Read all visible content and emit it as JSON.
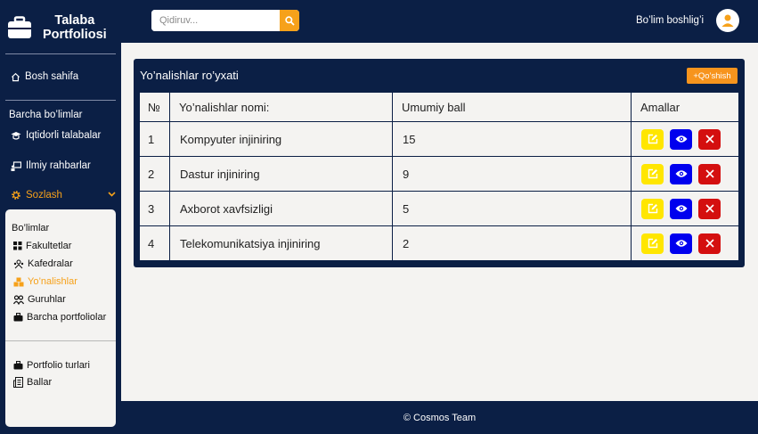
{
  "brand": {
    "line1": "Talaba",
    "line2": "Portfoliosi"
  },
  "sidebar": {
    "home": "Bosh sahifa",
    "section_label": "Barcha bo’limlar",
    "items": [
      {
        "label": "Iqtidorli talabalar"
      },
      {
        "label": "Ilmiy rahbarlar"
      },
      {
        "label": "Sozlash"
      }
    ],
    "submenu": {
      "title": "Bo’limlar",
      "items": [
        {
          "label": "Fakultetlar"
        },
        {
          "label": "Kafedralar"
        },
        {
          "label": "Yo’nalishlar"
        },
        {
          "label": "Guruhlar"
        },
        {
          "label": "Barcha portfoliolar"
        }
      ],
      "extra_items": [
        {
          "label": "Portfolio turlari"
        },
        {
          "label": "Ballar"
        }
      ]
    }
  },
  "header": {
    "search_placeholder": "Qidiruv...",
    "user_label": "Bo’lim boshlig’i"
  },
  "card": {
    "title": "Yo’nalishlar ro’yxati",
    "add_label": "+Qo’shish"
  },
  "table": {
    "headers": [
      "№",
      "Yo’nalishlar nomi:",
      "Umumiy ball",
      "Amallar"
    ],
    "rows": [
      {
        "num": "1",
        "name": "Kompyuter injiniring",
        "score": "15"
      },
      {
        "num": "2",
        "name": "Dastur injiniring",
        "score": "9"
      },
      {
        "num": "3",
        "name": "Axborot xavfsizligi",
        "score": "5"
      },
      {
        "num": "4",
        "name": "Telekomunikatsiya injiniring",
        "score": "2"
      }
    ]
  },
  "footer": {
    "text": "© Cosmos Team"
  },
  "colors": {
    "navy": "#0b1f45",
    "accent": "#f6a11a",
    "edit": "#ffe600",
    "view": "#0000ee",
    "delete": "#d40f0f"
  }
}
